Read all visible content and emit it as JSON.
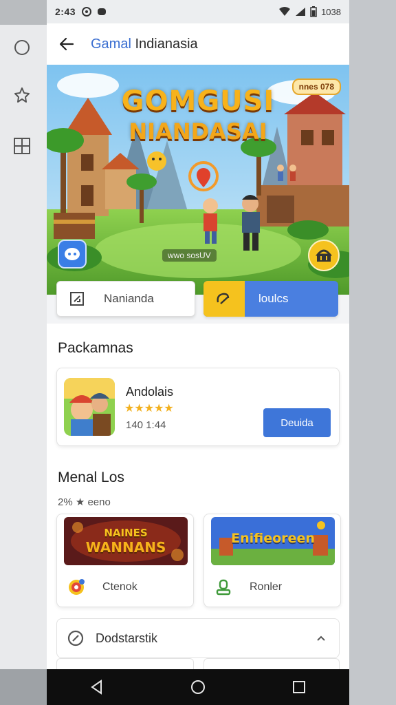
{
  "status_bar": {
    "time": "2:43",
    "battery": "1038"
  },
  "app_bar": {
    "title_part1": "Gamal",
    "title_part2": " Indianasia"
  },
  "banner": {
    "title_line1": "GOMGUSI",
    "title_line2": "NIANDASAI",
    "badge": "nnes 078",
    "caption": "wwo sosUV"
  },
  "actions": {
    "left_label": "Nanianda",
    "right_label": "loulcs"
  },
  "recommended": {
    "section_title": "Packamnas",
    "app": {
      "name": "Andolais",
      "stars": "★★★★★",
      "meta": "140 1:44",
      "button_label": "Deuida"
    }
  },
  "menu": {
    "section_title": "Menal Los",
    "subtitle": "2% ★ eeno",
    "cards": [
      {
        "image_title_1": "NAINES",
        "image_title_2": "WANNANS",
        "label": "Ctenok",
        "icon": "target-icon"
      },
      {
        "image_title_1": "Enifieoreen",
        "image_title_2": "",
        "label": "Ronler",
        "icon": "person-icon"
      }
    ]
  },
  "bottom_row": {
    "label": "Dodstarstik"
  },
  "colors": {
    "accent": "#3e76d9",
    "yellow": "#f5c21e"
  }
}
